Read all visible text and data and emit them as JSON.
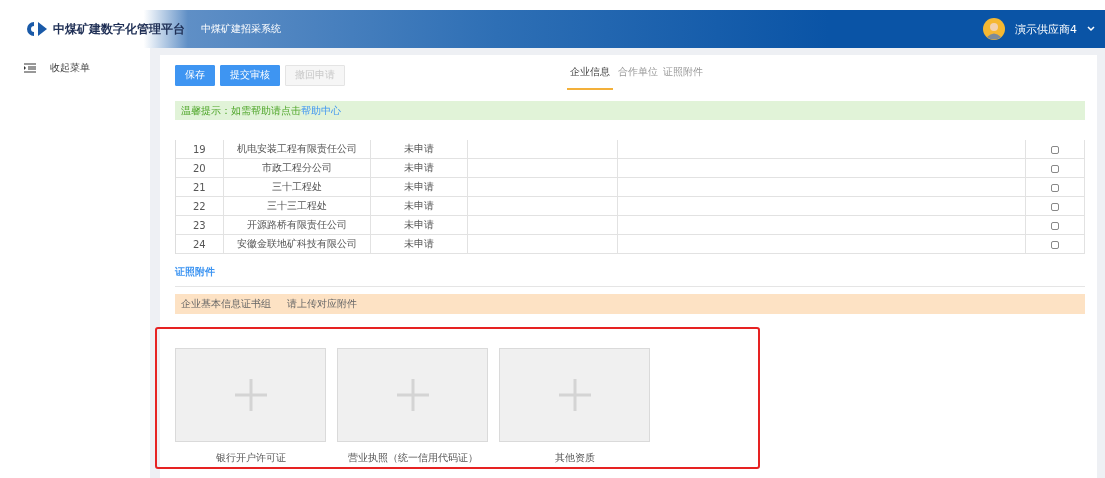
{
  "header": {
    "logo_text": "中煤矿建数字化管理平台",
    "system_name": "中煤矿建招采系统",
    "user_name": "演示供应商4"
  },
  "sidebar": {
    "collapse_label": "收起菜单"
  },
  "toolbar": {
    "buttons": [
      {
        "label": "保存",
        "disabled": false
      },
      {
        "label": "提交审核",
        "disabled": false
      },
      {
        "label": "撤回申请",
        "disabled": true
      }
    ],
    "tabs": [
      {
        "label": "企业信息",
        "selected": true
      },
      {
        "label": "合作单位",
        "selected": false
      },
      {
        "label": "证照附件",
        "selected": false
      }
    ]
  },
  "notice": {
    "text": "温馨提示：如需帮助请点击",
    "link": "帮助中心"
  },
  "table": {
    "rows": [
      {
        "no": "19",
        "name": "机电安装工程有限责任公司",
        "status": "未申请",
        "checked": false
      },
      {
        "no": "20",
        "name": "市政工程分公司",
        "status": "未申请",
        "checked": false
      },
      {
        "no": "21",
        "name": "三十工程处",
        "status": "未申请",
        "checked": false
      },
      {
        "no": "22",
        "name": "三十三工程处",
        "status": "未申请",
        "checked": false
      },
      {
        "no": "23",
        "name": "开源路桥有限责任公司",
        "status": "未申请",
        "checked": false
      },
      {
        "no": "24",
        "name": "安徽金联地矿科技有限公司",
        "status": "未申请",
        "checked": false
      }
    ]
  },
  "attachments": {
    "title": "证照附件",
    "group_label": "企业基本信息证书组",
    "group_hint": "请上传对应附件",
    "uploads": [
      {
        "label": "银行开户许可证"
      },
      {
        "label": "营业执照（统一信用代码证）"
      },
      {
        "label": "其他资质"
      }
    ]
  }
}
